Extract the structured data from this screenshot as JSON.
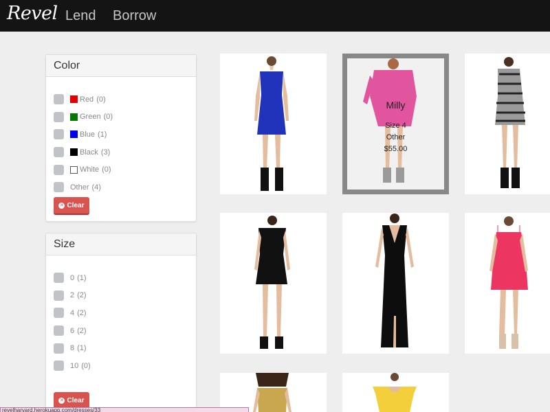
{
  "navbar": {
    "brand": "Revel",
    "links": [
      {
        "label": "Lend"
      },
      {
        "label": "Borrow"
      }
    ]
  },
  "filters": {
    "color": {
      "title": "Color",
      "options": [
        {
          "label": "Red",
          "count": "(0)",
          "swatch": "#e50000"
        },
        {
          "label": "Green",
          "count": "(0)",
          "swatch": "#007a00"
        },
        {
          "label": "Blue",
          "count": "(1)",
          "swatch": "#0000ee"
        },
        {
          "label": "Black",
          "count": "(3)",
          "swatch": "#000000"
        },
        {
          "label": "White",
          "count": "(0)",
          "swatch": "#ffffff"
        },
        {
          "label": "Other",
          "count": "(4)"
        }
      ],
      "clear_label": "Clear"
    },
    "size": {
      "title": "Size",
      "options": [
        {
          "label": "0",
          "count": "(1)"
        },
        {
          "label": "2",
          "count": "(2)"
        },
        {
          "label": "4",
          "count": "(2)"
        },
        {
          "label": "6",
          "count": "(2)"
        },
        {
          "label": "8",
          "count": "(1)"
        },
        {
          "label": "10",
          "count": "(0)"
        }
      ],
      "clear_label": "Clear"
    }
  },
  "colors": {
    "danger": "#d9534f",
    "navbar": "#141414",
    "page_background": "#eeeeee"
  },
  "products": [
    {
      "dress_color": "#2233bb"
    },
    {
      "dress_color": "#e0559e",
      "selected": true,
      "brand": "Milly",
      "size": "Size 4",
      "category": "Other",
      "price": "$55.00"
    },
    {
      "dress_color": "#9a9a9a"
    },
    {
      "dress_color": "#111111"
    },
    {
      "dress_color": "#0d0d0d"
    },
    {
      "dress_color": "#ec3560"
    },
    {
      "dress_color": "#c8a74f"
    },
    {
      "dress_color": "#f2cf3b"
    }
  ],
  "status_bar": {
    "url": "revelharvard.herokuapp.com/dresses/33"
  }
}
